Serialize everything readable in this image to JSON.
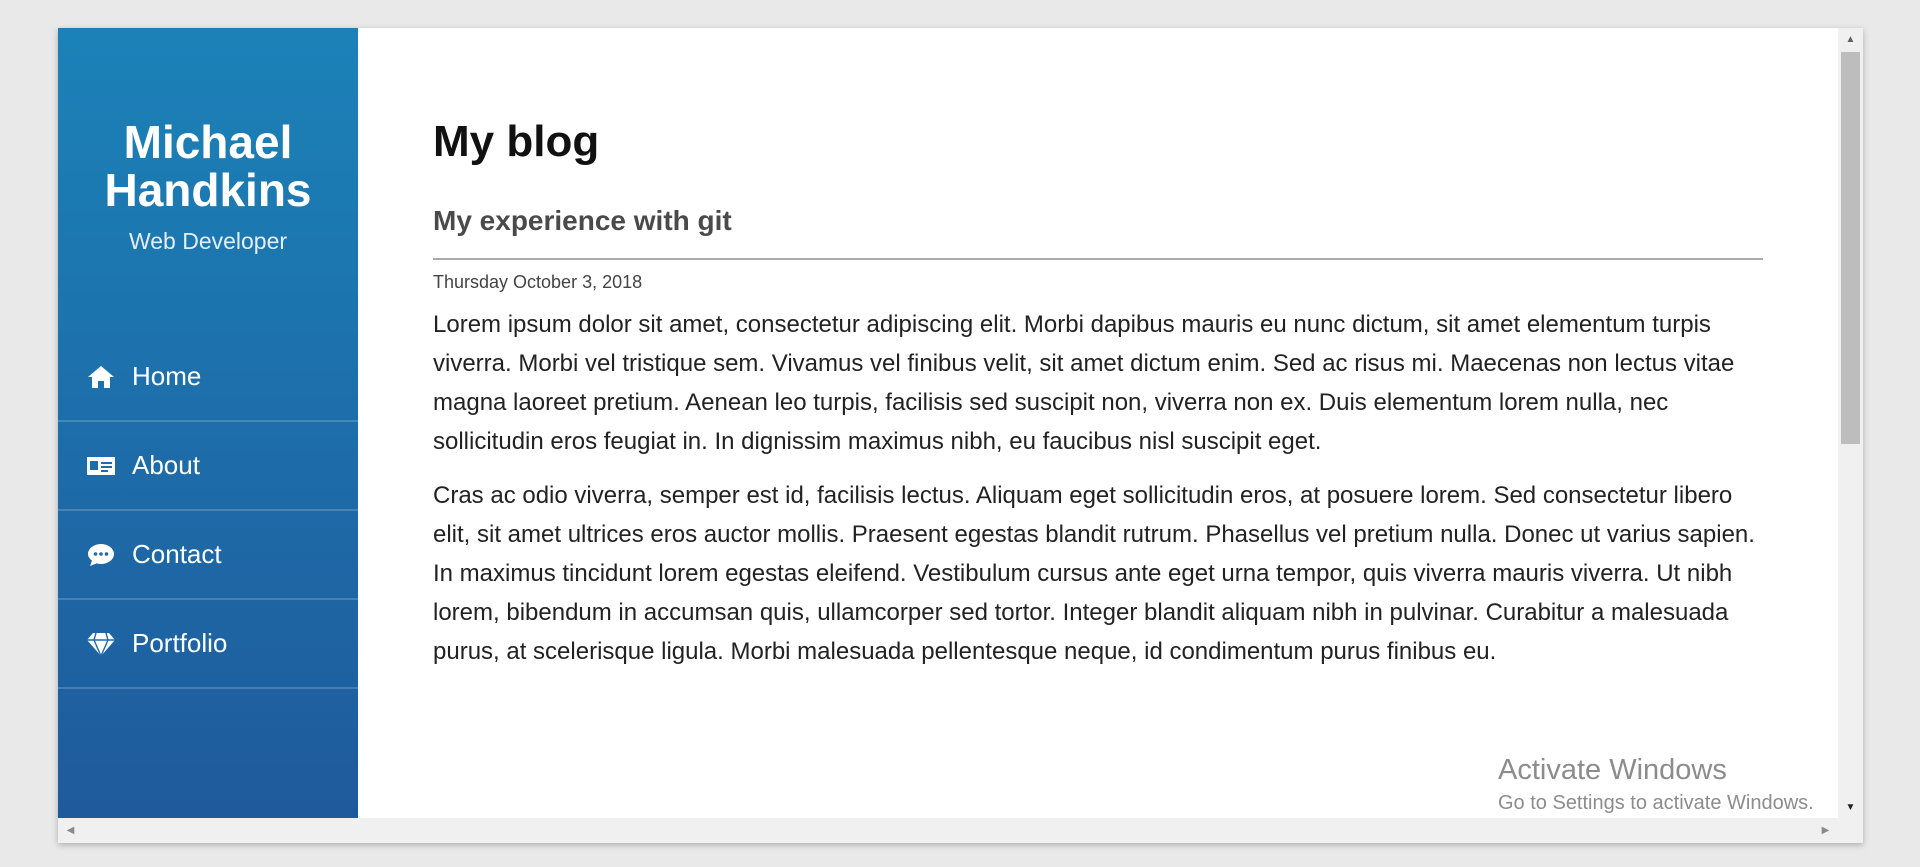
{
  "sidebar": {
    "name_line1": "Michael",
    "name_line2": "Handkins",
    "role": "Web Developer",
    "items": [
      {
        "label": "Home",
        "icon": "home-icon"
      },
      {
        "label": "About",
        "icon": "id-card-icon"
      },
      {
        "label": "Contact",
        "icon": "chat-bubble-icon"
      },
      {
        "label": "Portfolio",
        "icon": "diamond-icon"
      }
    ],
    "gradient_top": "#1b82b8",
    "gradient_bottom": "#1f5a9c"
  },
  "main": {
    "page_title": "My blog",
    "post": {
      "title": "My experience with git",
      "date": "Thursday October 3, 2018",
      "paragraphs": [
        "Lorem ipsum dolor sit amet, consectetur adipiscing elit. Morbi dapibus mauris eu nunc dictum, sit amet elementum turpis viverra. Morbi vel tristique sem. Vivamus vel finibus velit, sit amet dictum enim. Sed ac risus mi. Maecenas non lectus vitae magna laoreet pretium. Aenean leo turpis, facilisis sed suscipit non, viverra non ex. Duis elementum lorem nulla, nec sollicitudin eros feugiat in. In dignissim maximus nibh, eu faucibus nisl suscipit eget.",
        "Cras ac odio viverra, semper est id, facilisis lectus. Aliquam eget sollicitudin eros, at posuere lorem. Sed consectetur libero elit, sit amet ultrices eros auctor mollis. Praesent egestas blandit rutrum. Phasellus vel pretium nulla. Donec ut varius sapien. In maximus tincidunt lorem egestas eleifend. Vestibulum cursus ante eget urna tempor, quis viverra mauris viverra. Ut nibh lorem, bibendum in accumsan quis, ullamcorper sed tortor. Integer blandit aliquam nibh in pulvinar. Curabitur a malesuada purus, at scelerisque ligula. Morbi malesuada pellentesque neque, id condimentum purus finibus eu."
      ]
    }
  },
  "watermark": {
    "title": "Activate Windows",
    "subtitle": "Go to Settings to activate Windows."
  }
}
